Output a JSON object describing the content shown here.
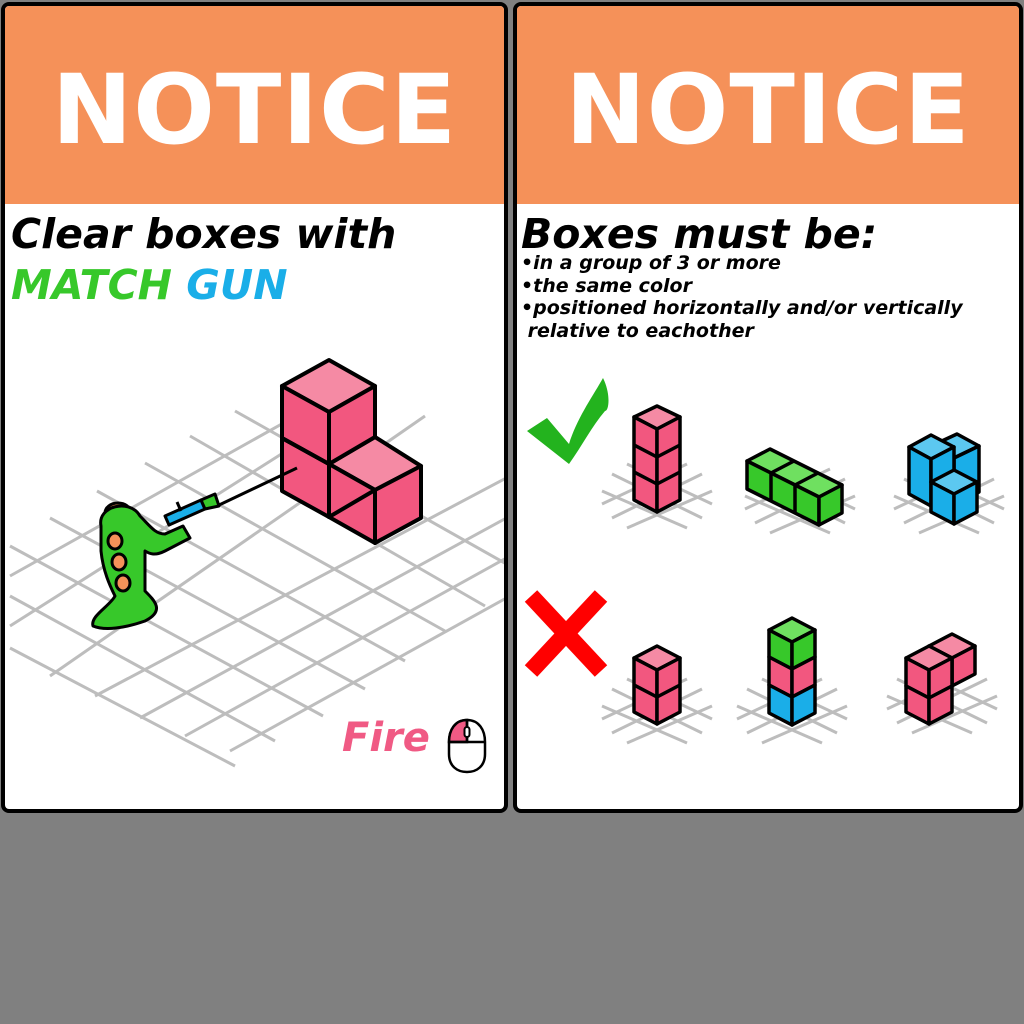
{
  "left_panel": {
    "banner": "NOTICE",
    "heading_line1": "Clear boxes with",
    "heading_match": "MATCH",
    "heading_gun": "GUN",
    "fire_label": "Fire"
  },
  "right_panel": {
    "banner": "NOTICE",
    "heading": "Boxes must be:",
    "rules": [
      "•in a group of 3 or more",
      "•the same color",
      "•positioned horizontally and/or vertically",
      " relative to eachother"
    ]
  },
  "colors": {
    "banner": "#f59159",
    "pink": "#f2577f",
    "green": "#37c82a",
    "blue": "#1aaee8",
    "match_green": "#37c82a",
    "gun_blue": "#1aaee8",
    "fire_pink": "#f05a84",
    "check_green": "#23b31e",
    "cross_red": "#ff0000"
  },
  "icons": [
    "mouse-left-click-icon",
    "checkmark-icon",
    "cross-icon",
    "frog-character-icon",
    "match-gun-icon"
  ]
}
